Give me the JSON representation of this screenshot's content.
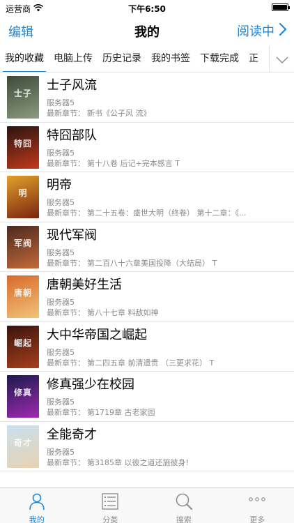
{
  "status_bar": {
    "carrier": "运营商",
    "time": "下午6:50"
  },
  "nav": {
    "left_label": "编辑",
    "title": "我的",
    "right_label": "阅读中"
  },
  "tabs": [
    {
      "label": "我的收藏",
      "active": true
    },
    {
      "label": "电脑上传",
      "active": false
    },
    {
      "label": "历史记录",
      "active": false
    },
    {
      "label": "我的书签",
      "active": false
    },
    {
      "label": "下载完成",
      "active": false
    },
    {
      "label": "正",
      "active": false
    }
  ],
  "chapter_label": "最新章节：",
  "books": [
    {
      "title": "士子风流",
      "server": "服务器5",
      "chapter": "新书《公子风 流》",
      "cover_text": "士子",
      "cover_colors": [
        "#3d4a3a",
        "#8c9b7e"
      ]
    },
    {
      "title": "特囧部队",
      "server": "服务器5",
      "chapter": "第十八卷 后记+完本感言 T",
      "cover_text": "特囧",
      "cover_colors": [
        "#2a1410",
        "#c23a1c"
      ]
    },
    {
      "title": "明帝",
      "server": "服务器5",
      "chapter": "第二十五卷：盛世大明（终卷） 第十二章：《...",
      "cover_text": "明",
      "cover_colors": [
        "#e0a12a",
        "#7a2410"
      ]
    },
    {
      "title": "现代军阀",
      "server": "服务器5",
      "chapter": "第二百八十六章美国投降（大结局） T",
      "cover_text": "军阀",
      "cover_colors": [
        "#4a2a20",
        "#c46a3a"
      ]
    },
    {
      "title": "唐朝美好生活",
      "server": "服务器5",
      "chapter": "第八十七章 料敌如神",
      "cover_text": "唐朝",
      "cover_colors": [
        "#d86a2a",
        "#f2c27a"
      ]
    },
    {
      "title": "大中华帝国之崛起",
      "server": "服务器5",
      "chapter": "第二四五章 前清遗贵 （三更求花） T",
      "cover_text": "崛起",
      "cover_colors": [
        "#3a140e",
        "#a8401c"
      ]
    },
    {
      "title": "修真强少在校园",
      "server": "服务器5",
      "chapter": "第1719章 古老家园",
      "cover_text": "修真",
      "cover_colors": [
        "#1c1a4a",
        "#a02ab4"
      ]
    },
    {
      "title": "全能奇才",
      "server": "服务器5",
      "chapter": "第3185章 以彼之道还施彼身!",
      "cover_text": "奇才",
      "cover_colors": [
        "#c8e0ee",
        "#e8d2b2"
      ]
    }
  ],
  "tab_bar": [
    {
      "label": "我的",
      "icon": "person-icon",
      "active": true
    },
    {
      "label": "分类",
      "icon": "list-icon",
      "active": false
    },
    {
      "label": "搜索",
      "icon": "search-icon",
      "active": false
    },
    {
      "label": "更多",
      "icon": "more-icon",
      "active": false
    }
  ],
  "colors": {
    "accent": "#1e88d8",
    "muted_text": "#8a8a8a"
  }
}
